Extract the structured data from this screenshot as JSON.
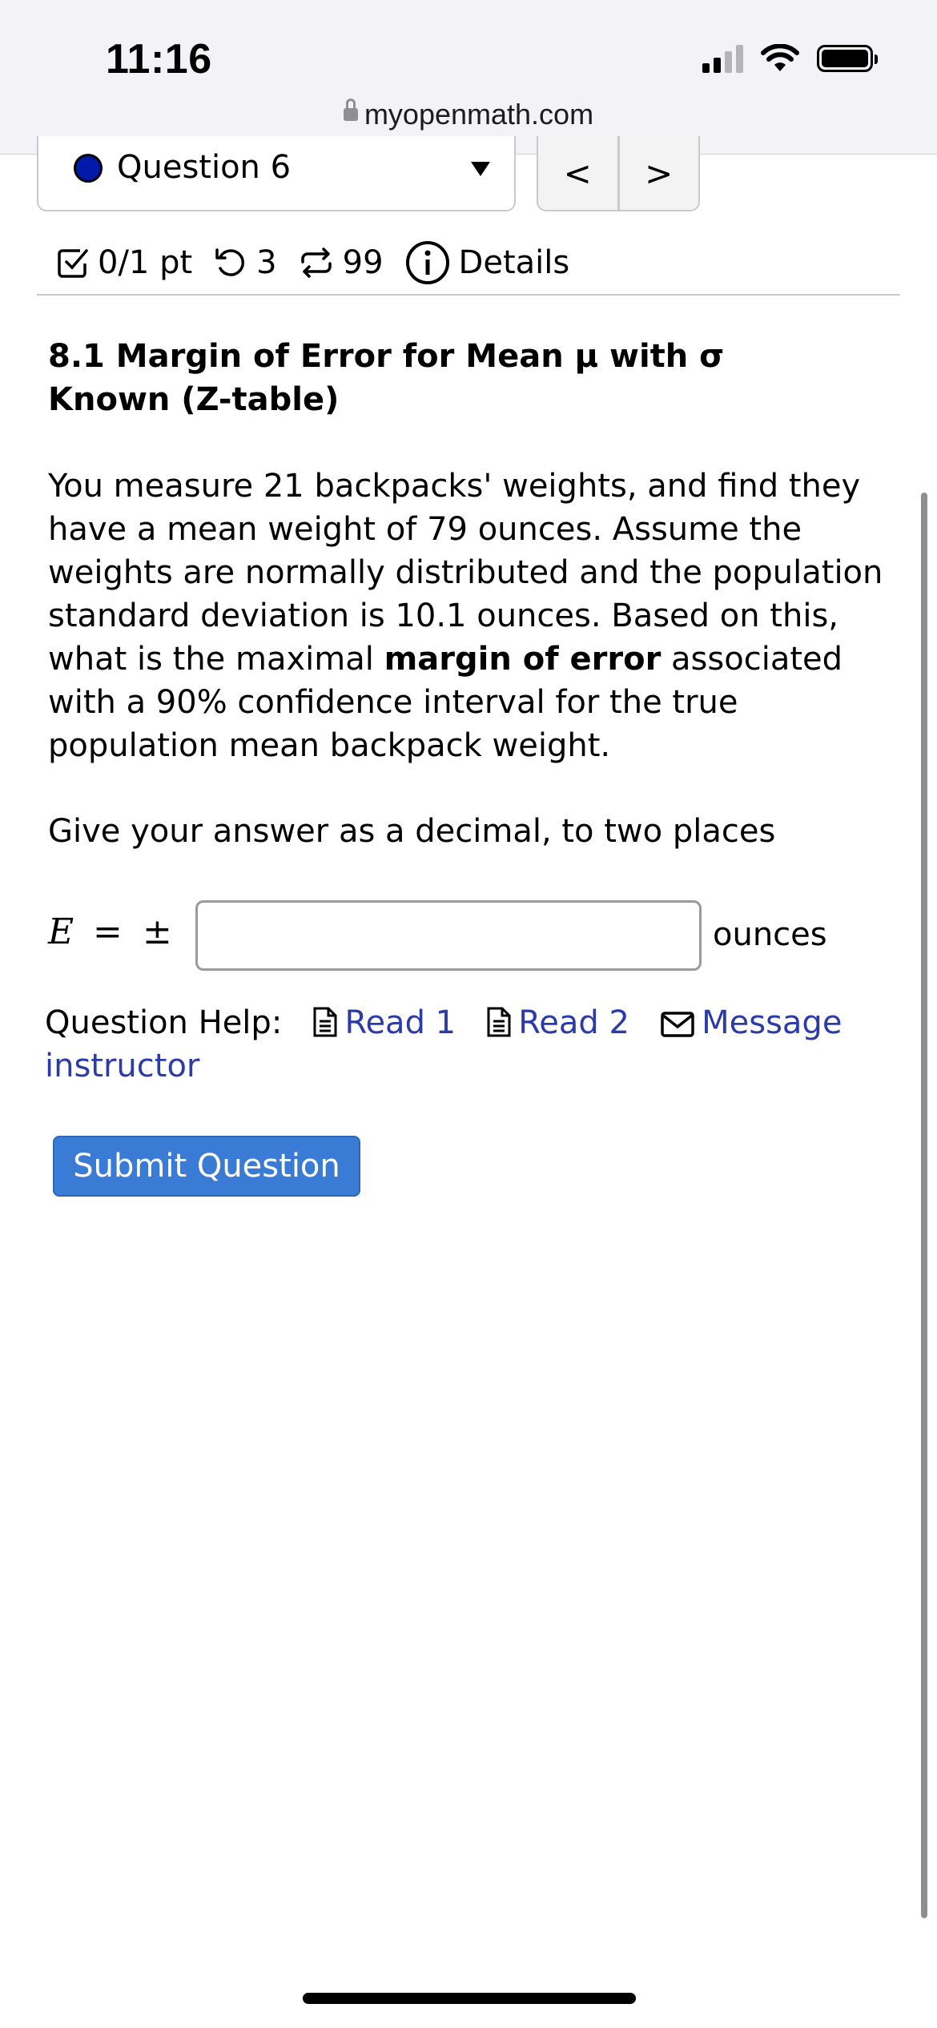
{
  "status_bar": {
    "time": "11:16"
  },
  "browser": {
    "url": "myopenmath.com"
  },
  "question_nav": {
    "label": "Question 6",
    "prev": "<",
    "next": ">"
  },
  "meta": {
    "points": "0/1 pt",
    "retries": "3",
    "regens": "99",
    "details": "Details"
  },
  "question": {
    "title": "8.1 Margin of Error for Mean μ with σ Known (Z-table)",
    "text_before": "You measure 21 backpacks' weights, and find they have a mean weight of 79 ounces. Assume the weights are normally distributed and the population standard deviation is 10.1 ounces. Based on this, what is the maximal ",
    "text_bold": "margin of error",
    "text_after": " associated with a 90% confidence interval for the true population mean backpack weight.",
    "instruction": "Give your answer as a decimal, to two places"
  },
  "answer": {
    "variable": "E",
    "equals": "=",
    "plus_minus": "±",
    "value": "",
    "unit": "ounces"
  },
  "help": {
    "label": "Question Help:",
    "read1": "Read 1",
    "read2": "Read 2",
    "message": "Message instructor"
  },
  "submit_label": "Submit Question",
  "colors": {
    "link": "#2b3ba8",
    "submit": "#3a7bd5",
    "question_dot": "#0019a8"
  }
}
